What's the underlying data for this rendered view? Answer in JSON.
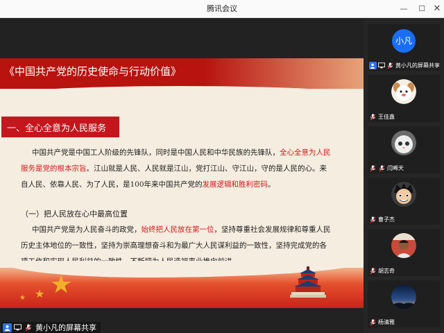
{
  "window": {
    "title": "腾讯会议",
    "minimize": "—",
    "maximize": "☐",
    "close": "✕"
  },
  "slide": {
    "title": "《中国共产党的历史使命与行动价值》",
    "section": "一、全心全意为人民服务",
    "p1": [
      {
        "pre": "中国共产党是中国工人阶级的先锋队，同时是中国人民和中华民族的先锋队，",
        "hl": "全心全意为人民",
        "post": ""
      },
      {
        "pre": "",
        "hl": "服务是党的根本宗旨",
        "post": "。江山就是人民、人民就是江山，党打江山、守江山，守的是人民的心。来"
      },
      {
        "pre": "自人民、依靠人民、为了人民，是100年来中国共产党的",
        "hl": "发展逻辑和胜利密码",
        "post": "。"
      }
    ],
    "sub_heading": "（一）把人民放在心中最高位置",
    "p2": [
      {
        "pre": "中国共产党是为人民奋斗的政党，",
        "hl": "始终把人民放在第一位",
        "post": "，坚持尊重社会发展规律和尊重人民"
      },
      {
        "pre": "历史主体地位的一致性，坚持为崇高理想奋斗和为最广大人民谋利益的一致性，坚持完成党的各",
        "hl": "",
        "post": ""
      },
      {
        "pre": "项工作和实现人民利益的一致性，不断把为人民造福事业推向前进。",
        "hl": "",
        "post": ""
      }
    ]
  },
  "screen_share_tag": "黄小凡的屏幕共享",
  "participants": [
    {
      "name": "黄小凡的屏幕共享",
      "avatar_text": "小凡",
      "avatar_color": "#1a6ef5",
      "sharing": true
    },
    {
      "name": "王佳鑫",
      "avatar": "cartoon-dog"
    },
    {
      "name": "闫晞天",
      "avatar": "white-cat"
    },
    {
      "name": "曹子杰",
      "avatar": "anime-face"
    },
    {
      "name": "胡志奇",
      "avatar": "photo-person"
    },
    {
      "name": "杨清雅",
      "avatar": "night-sky"
    }
  ],
  "colors": {
    "accent_red": "#c4161c",
    "highlight_red": "#d3191a",
    "share_blue": "#2e6ff2"
  }
}
